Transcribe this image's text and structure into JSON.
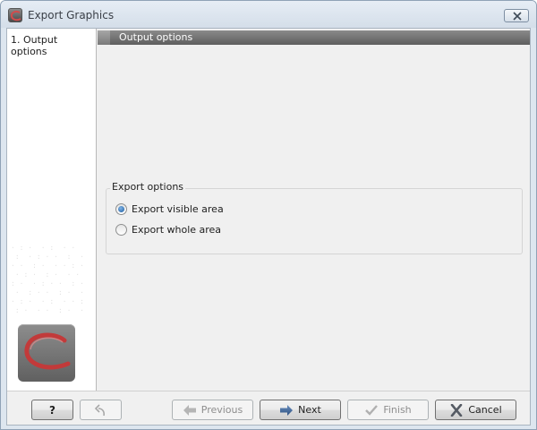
{
  "window": {
    "title": "Export Graphics"
  },
  "sidebar": {
    "steps": [
      {
        "label": "1. Output options"
      }
    ]
  },
  "main": {
    "section_title": "Output options",
    "export_options": {
      "group_label": "Export options",
      "options": [
        {
          "label": "Export visible area",
          "selected": true
        },
        {
          "label": "Export whole area",
          "selected": false
        }
      ]
    }
  },
  "footer": {
    "help_label": "?",
    "previous_label": "Previous",
    "next_label": "Next",
    "finish_label": "Finish",
    "cancel_label": "Cancel"
  },
  "icons": {
    "app": "app-logo-icon",
    "close": "close-icon",
    "undo": "undo-arrow-icon",
    "previous": "arrow-left-icon",
    "next": "arrow-right-icon",
    "finish": "checkmark-icon",
    "cancel": "x-icon"
  },
  "colors": {
    "accent": "#1b5b9e",
    "section_header": "#6e6e6e",
    "logo_swoosh": "#c23a3a"
  }
}
